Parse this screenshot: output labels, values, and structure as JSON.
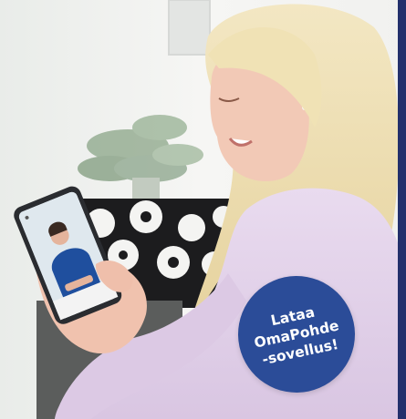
{
  "badge": {
    "lines": [
      "Lataa",
      "OmaPohde",
      "-sovellus!"
    ],
    "background": "#2b4c98",
    "text_color": "#ffffff"
  },
  "photo": {
    "subject": "smiling blonde woman in pink knit sweater holding a smartphone",
    "phone_screen": "video call with a healthcare professional in blue uniform"
  },
  "colors": {
    "wall": "#f2f3f2",
    "sweater": "#e3d2ea",
    "hair": "#efe0b3",
    "skin": "#f2c9b6",
    "navy_edge": "#23306c"
  }
}
